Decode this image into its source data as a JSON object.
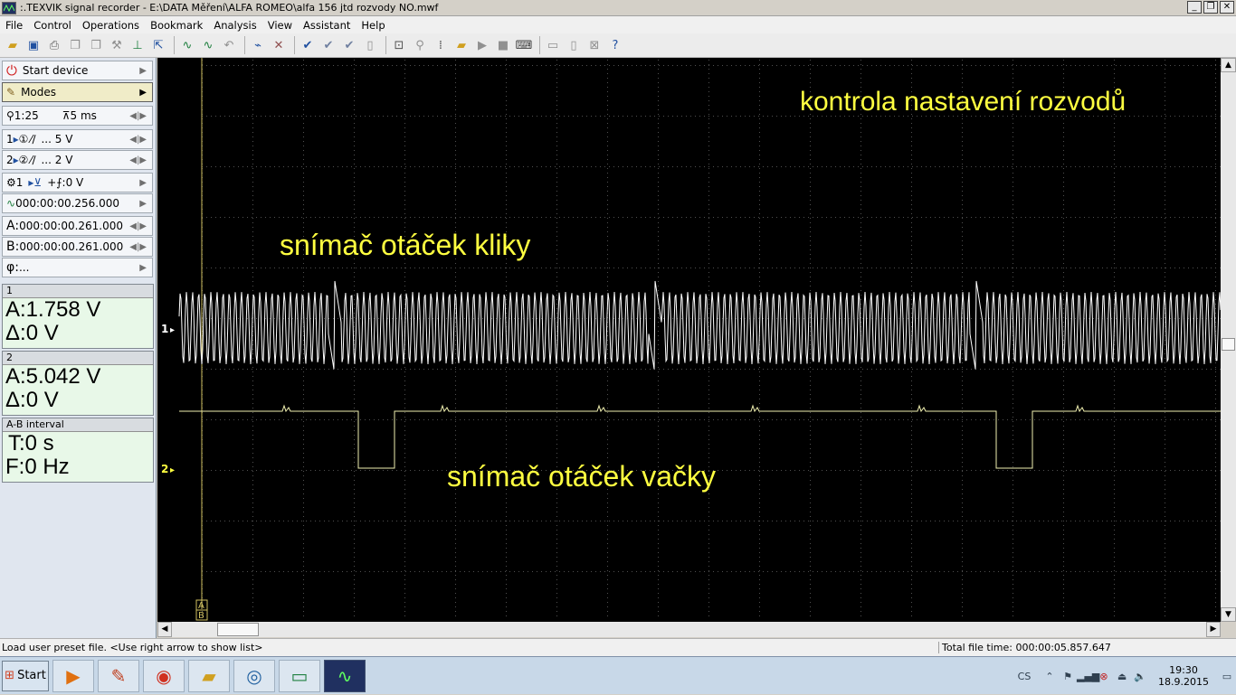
{
  "window": {
    "title": ":.TEXVIK  signal recorder - E:\\DATA Měření\\ALFA ROMEO\\alfa 156 jtd rozvody NO.mwf",
    "buttons": [
      "_",
      "❐",
      "✕"
    ]
  },
  "menu": [
    "File",
    "Control",
    "Operations",
    "Bookmark",
    "Analysis",
    "View",
    "Assistant",
    "Help"
  ],
  "side": {
    "start_device": "Start device",
    "modes": "Modes",
    "zoom": "1:25",
    "timebase": "5 ms",
    "ch1_label": "1",
    "ch1_range": "... 5 V",
    "ch2_label": "2",
    "ch2_range": "... 2 V",
    "trig_ch": "1",
    "trig_level": "0 V",
    "trig_time": "000:00:00.256.000",
    "cursor_a_label": "A:",
    "cursor_a": "000:00:00.261.000",
    "cursor_b_label": "B:",
    "cursor_b": "000:00:00.261.000",
    "phi_label": "φ:",
    "phi": "..."
  },
  "meas": [
    {
      "head": "1",
      "a": "A:1.758 V",
      "d": "Δ:0 V"
    },
    {
      "head": "2",
      "a": "A:5.042 V",
      "d": "Δ:0 V"
    }
  ],
  "interval": {
    "head": "A-B interval",
    "t": "T:0 s",
    "f": "F:0 Hz"
  },
  "scope": {
    "title": "kontrola nastavení rozvodů",
    "label_crank": "snímač otáček kliky",
    "label_cam": "snímač otáček vačky",
    "ch1_marker": "1",
    "ch2_marker": "2",
    "cursor_tag_a": "A",
    "cursor_tag_b": "B",
    "trace_color": "#ffffff",
    "cam_color": "#f0f0b0",
    "text_color": "#ffff40",
    "grid_color": "#505050"
  },
  "status": {
    "left": "Load user preset file. <Use right arrow to show list>",
    "right": "Total file time: 000:00:05.857.647"
  },
  "taskbar": {
    "start": "Start",
    "lang": "CS",
    "time": "19:30",
    "date": "18.9.2015"
  }
}
